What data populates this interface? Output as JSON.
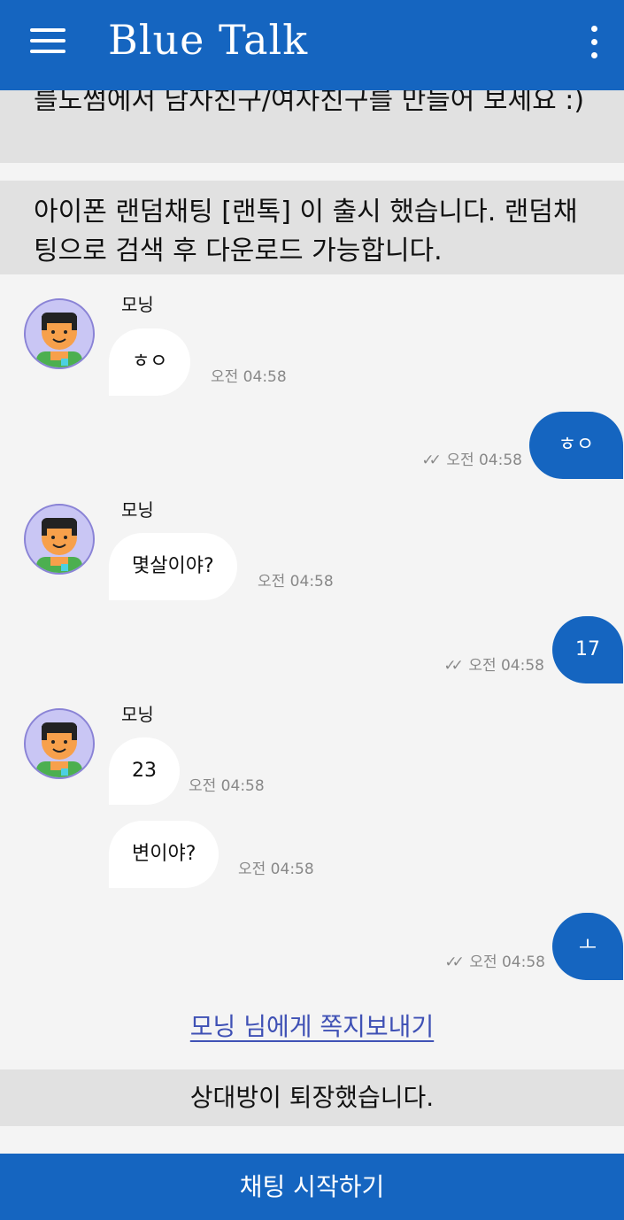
{
  "app": {
    "title": "Blue Talk"
  },
  "notices": [
    "를도썸에서 남자친구/여자친구를 만들어 보세요 :)",
    "아이폰 랜덤채팅 [랜톡] 이 출시 했습니다. 랜덤채팅으로 검색 후 다운로드 가능합니다."
  ],
  "messages": [
    {
      "dir": "in",
      "sender": "모닝",
      "text": "ㅎㅇ",
      "time": "오전 04:58"
    },
    {
      "dir": "out",
      "text": "ㅎㅇ",
      "time": "오전 04:58",
      "read": "✓✓"
    },
    {
      "dir": "in",
      "sender": "모닝",
      "text": "몇살이야?",
      "time": "오전 04:58"
    },
    {
      "dir": "out",
      "text": "17",
      "time": "오전 04:58",
      "read": "✓✓"
    },
    {
      "dir": "in",
      "sender": "모닝",
      "text": "23",
      "time": "오전 04:58"
    },
    {
      "dir": "in",
      "text": "변이야?",
      "time": "오전 04:58"
    },
    {
      "dir": "out",
      "text": "ㅗ",
      "time": "오전 04:58",
      "read": "✓✓"
    }
  ],
  "note_link": "모닝 님에게 쪽지보내기",
  "partner_left": "상대방이 퇴장했습니다.",
  "start_button": "채팅 시작하기",
  "colors": {
    "primary": "#1565c0",
    "link": "#3f51b5"
  }
}
